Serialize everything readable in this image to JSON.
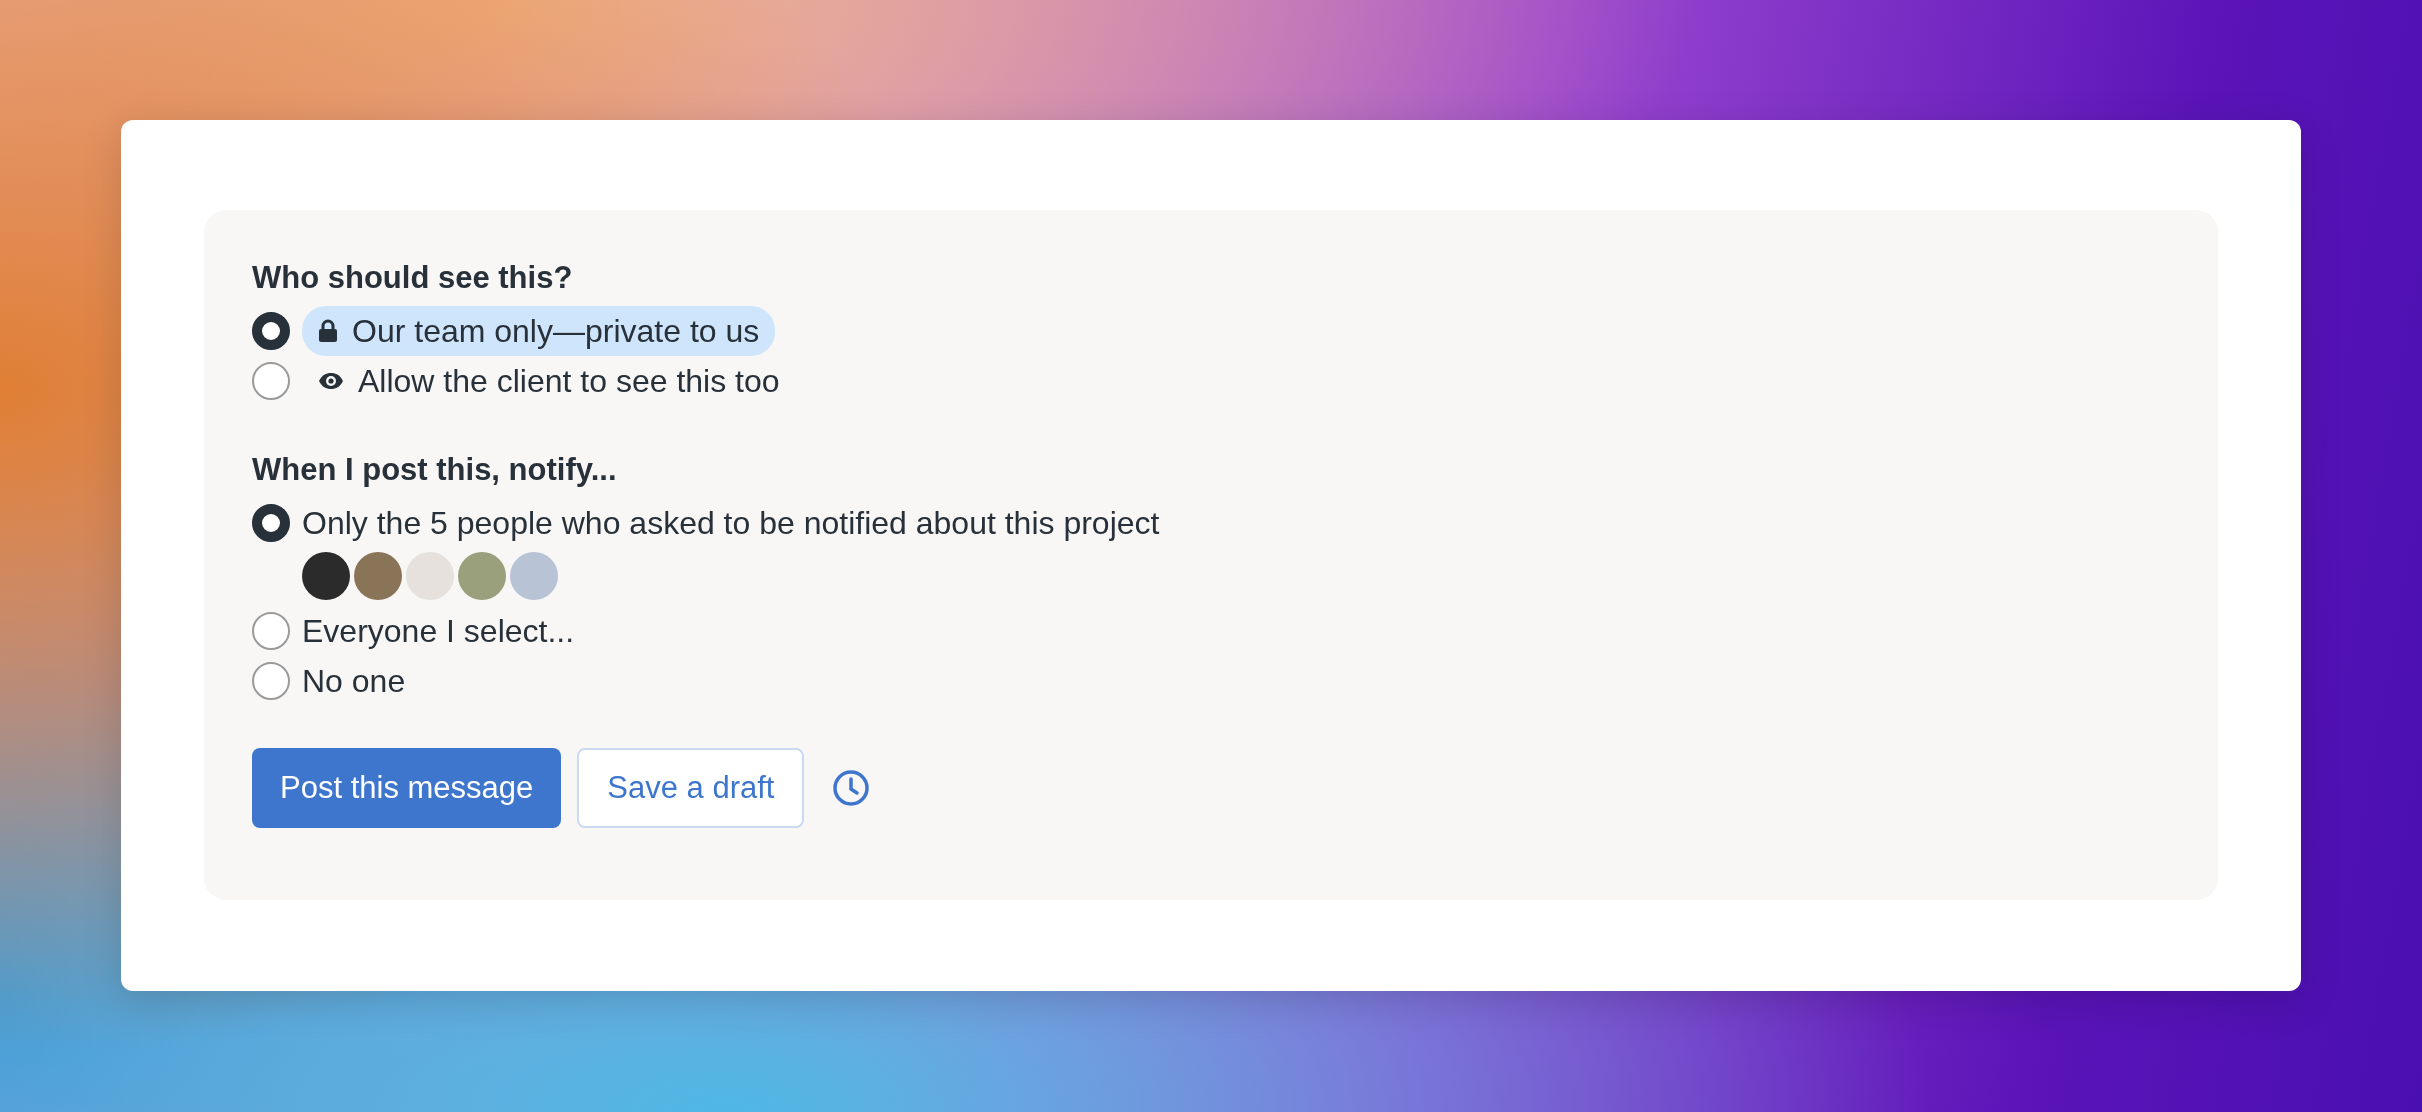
{
  "groups": [
    {
      "title": "Who should see this?",
      "kind": "badge",
      "options": [
        {
          "label": "Our team only—private to us",
          "kind": "lock",
          "selected": true
        },
        {
          "label": "Allow the client to see this too",
          "kind": "eye",
          "selected": false
        }
      ]
    },
    {
      "title": "When I post this, notify...",
      "kind": "plain",
      "options": [
        {
          "label": "Only the 5 people who asked to be notified about this project",
          "selected": true,
          "avatars": [
            {
              "color": "#2b2b2b"
            },
            {
              "color": "#8a7458"
            },
            {
              "color": "#e6e1dc"
            },
            {
              "color": "#9a9f7c"
            },
            {
              "color": "#b8c3d6"
            }
          ]
        },
        {
          "label": "Everyone I select...",
          "selected": false
        },
        {
          "label": "No one",
          "selected": false
        }
      ]
    }
  ],
  "buttons": [
    {
      "kind": "primary",
      "label": "Post this message"
    },
    {
      "kind": "secondary",
      "label": "Save a draft"
    },
    {
      "kind": "clock"
    }
  ]
}
